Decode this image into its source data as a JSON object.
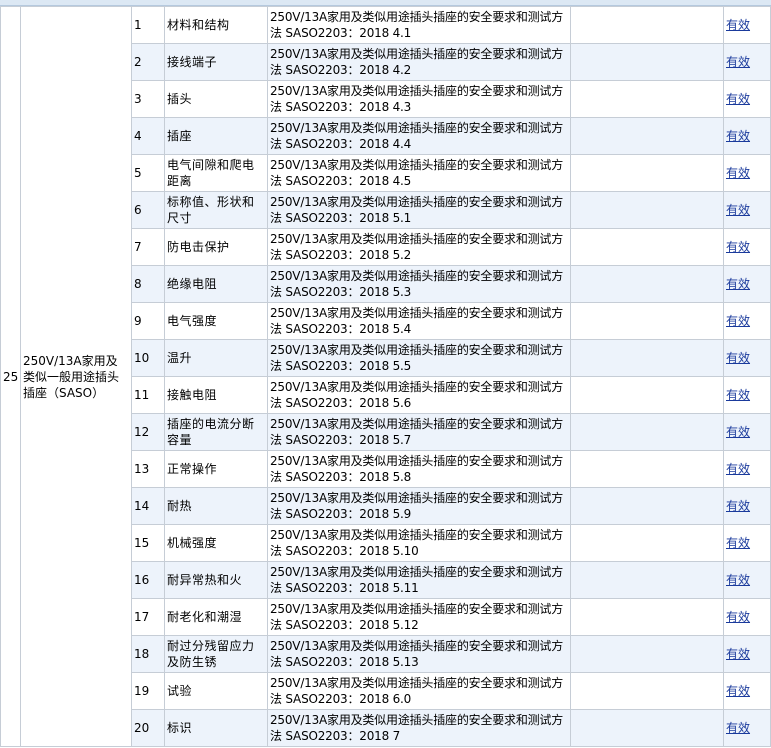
{
  "group": {
    "seq": "25",
    "product": "250V/13A家用及类似一般用途插头插座（SASO）"
  },
  "rows": [
    {
      "no": "1",
      "item": "材料和结构",
      "standard": "250V/13A家用及类似用途插头插座的安全要求和测试方法 SASO2203：2018 4.1",
      "status": "有效"
    },
    {
      "no": "2",
      "item": "接线端子",
      "standard": "250V/13A家用及类似用途插头插座的安全要求和测试方法 SASO2203：2018 4.2",
      "status": "有效"
    },
    {
      "no": "3",
      "item": "插头",
      "standard": "250V/13A家用及类似用途插头插座的安全要求和测试方法 SASO2203：2018 4.3",
      "status": "有效"
    },
    {
      "no": "4",
      "item": "插座",
      "standard": "250V/13A家用及类似用途插头插座的安全要求和测试方法 SASO2203：2018 4.4",
      "status": "有效"
    },
    {
      "no": "5",
      "item": "电气间隙和爬电距离",
      "standard": "250V/13A家用及类似用途插头插座的安全要求和测试方法 SASO2203：2018 4.5",
      "status": "有效"
    },
    {
      "no": "6",
      "item": "标称值、形状和尺寸",
      "standard": "250V/13A家用及类似用途插头插座的安全要求和测试方法 SASO2203：2018 5.1",
      "status": "有效"
    },
    {
      "no": "7",
      "item": "防电击保护",
      "standard": "250V/13A家用及类似用途插头插座的安全要求和测试方法 SASO2203：2018 5.2",
      "status": "有效"
    },
    {
      "no": "8",
      "item": "绝缘电阻",
      "standard": "250V/13A家用及类似用途插头插座的安全要求和测试方法 SASO2203：2018 5.3",
      "status": "有效"
    },
    {
      "no": "9",
      "item": "电气强度",
      "standard": "250V/13A家用及类似用途插头插座的安全要求和测试方法 SASO2203：2018 5.4",
      "status": "有效"
    },
    {
      "no": "10",
      "item": "温升",
      "standard": "250V/13A家用及类似用途插头插座的安全要求和测试方法 SASO2203：2018 5.5",
      "status": "有效"
    },
    {
      "no": "11",
      "item": "接触电阻",
      "standard": "250V/13A家用及类似用途插头插座的安全要求和测试方法 SASO2203：2018 5.6",
      "status": "有效"
    },
    {
      "no": "12",
      "item": "插座的电流分断容量",
      "standard": "250V/13A家用及类似用途插头插座的安全要求和测试方法 SASO2203：2018 5.7",
      "status": "有效"
    },
    {
      "no": "13",
      "item": "正常操作",
      "standard": "250V/13A家用及类似用途插头插座的安全要求和测试方法 SASO2203：2018 5.8",
      "status": "有效"
    },
    {
      "no": "14",
      "item": "耐热",
      "standard": "250V/13A家用及类似用途插头插座的安全要求和测试方法 SASO2203：2018 5.9",
      "status": "有效"
    },
    {
      "no": "15",
      "item": "机械强度",
      "standard": "250V/13A家用及类似用途插头插座的安全要求和测试方法 SASO2203：2018 5.10",
      "status": "有效"
    },
    {
      "no": "16",
      "item": "耐异常热和火",
      "standard": "250V/13A家用及类似用途插头插座的安全要求和测试方法 SASO2203：2018 5.11",
      "status": "有效"
    },
    {
      "no": "17",
      "item": "耐老化和潮湿",
      "standard": "250V/13A家用及类似用途插头插座的安全要求和测试方法 SASO2203：2018 5.12",
      "status": "有效"
    },
    {
      "no": "18",
      "item": "耐过分残留应力及防生锈",
      "standard": "250V/13A家用及类似用途插头插座的安全要求和测试方法 SASO2203：2018 5.13",
      "status": "有效"
    },
    {
      "no": "19",
      "item": "试验",
      "standard": "250V/13A家用及类似用途插头插座的安全要求和测试方法 SASO2203：2018 6.0",
      "status": "有效"
    },
    {
      "no": "20",
      "item": "标识",
      "standard": "250V/13A家用及类似用途插头插座的安全要求和测试方法 SASO2203：2018 7",
      "status": "有效"
    }
  ]
}
